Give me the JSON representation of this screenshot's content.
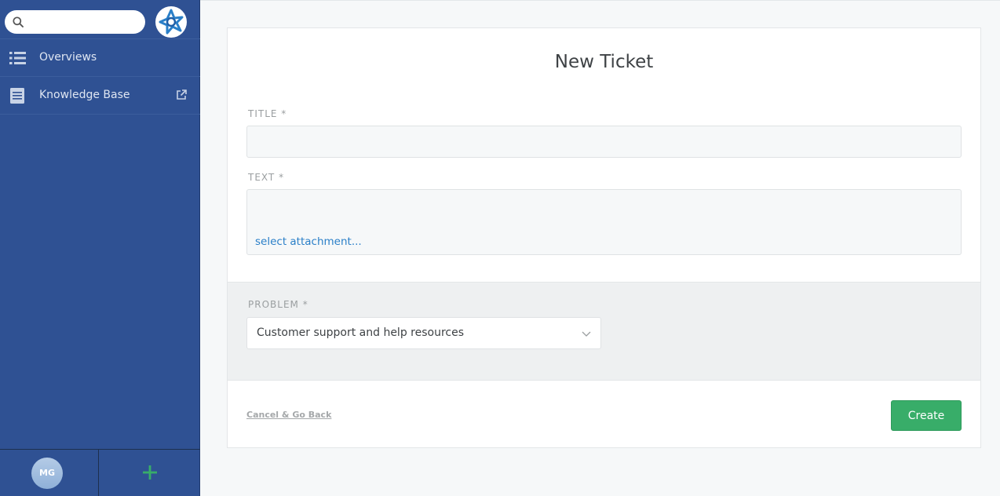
{
  "search": {
    "value": "",
    "placeholder": ""
  },
  "sidebar": {
    "items": [
      {
        "label": "Overviews"
      },
      {
        "label": "Knowledge Base"
      }
    ],
    "user_initials": "MG"
  },
  "form": {
    "heading": "New Ticket",
    "title_label": "TITLE *",
    "title_value": "",
    "text_label": "TEXT *",
    "attachment_link": "select attachment...",
    "problem_label": "PROBLEM *",
    "problem_value": "Customer support and help resources",
    "cancel_label": "Cancel & Go Back",
    "create_label": "Create"
  },
  "colors": {
    "sidebar_bg": "#2f5193",
    "create_button": "#38ad69",
    "link": "#2a7fc8",
    "add_icon": "#38ad69"
  },
  "icons": {
    "search": "search-icon",
    "logo": "zammad-logo",
    "overviews": "list-icon",
    "knowledge_base": "book-icon",
    "external": "external-link-icon",
    "add": "plus-icon",
    "select": "chevron-down-icon"
  }
}
